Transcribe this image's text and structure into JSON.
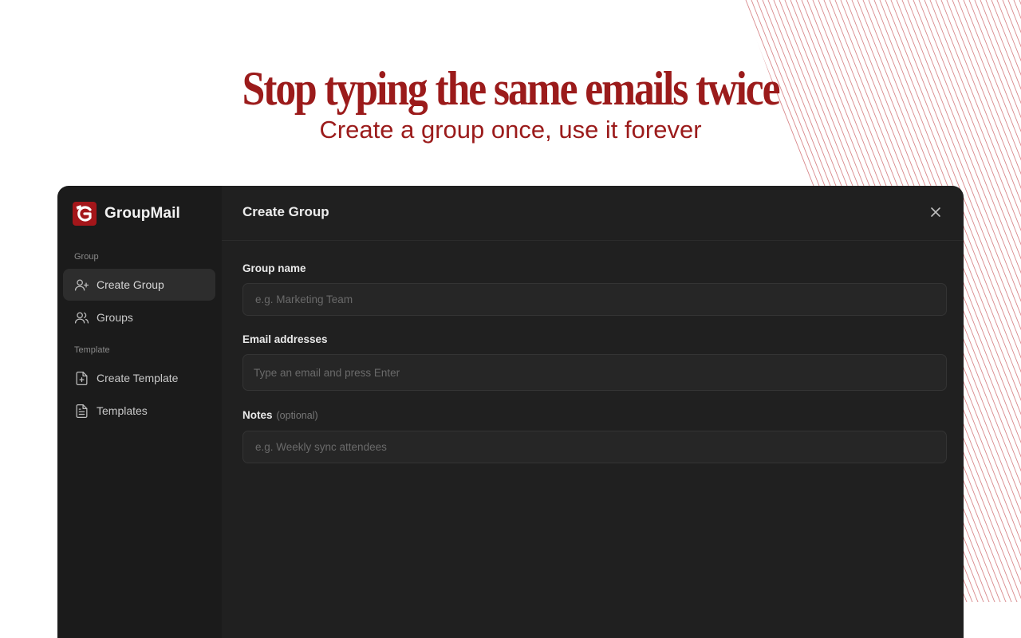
{
  "hero": {
    "headline": "Stop typing the same emails twice",
    "subheadline": "Create a group once, use it forever",
    "accent_color": "#9b1b1b"
  },
  "app": {
    "brand_name": "GroupMail",
    "logo_icon": "groupmail-logo-icon",
    "colors": {
      "sidebar_bg": "#1b1b1b",
      "main_bg": "#202020",
      "active_item_bg": "#2d2d2d",
      "brand_red": "#a4161a"
    }
  },
  "sidebar": {
    "sections": [
      {
        "label": "Group",
        "items": [
          {
            "label": "Create Group",
            "icon": "user-plus-icon",
            "active": true
          },
          {
            "label": "Groups",
            "icon": "users-icon",
            "active": false
          }
        ]
      },
      {
        "label": "Template",
        "items": [
          {
            "label": "Create Template",
            "icon": "file-plus-icon",
            "active": false
          },
          {
            "label": "Templates",
            "icon": "file-text-icon",
            "active": false
          }
        ]
      }
    ]
  },
  "main": {
    "title": "Create Group",
    "close_icon": "close-icon",
    "form": {
      "group_name": {
        "label": "Group name",
        "placeholder": "e.g. Marketing Team",
        "value": ""
      },
      "emails": {
        "label": "Email addresses",
        "placeholder": "Type an email and press Enter",
        "value": ""
      },
      "notes": {
        "label": "Notes",
        "optional_text": "(optional)",
        "placeholder": "e.g. Weekly sync attendees",
        "value": ""
      }
    }
  }
}
